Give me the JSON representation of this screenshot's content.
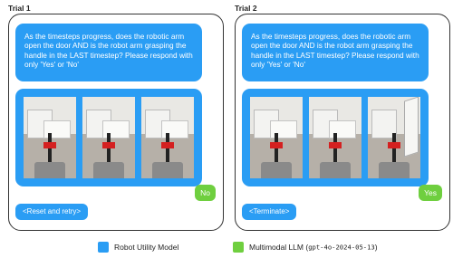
{
  "colors": {
    "robot_utility_blue": "#2a9df4",
    "llm_green": "#6fcf3f"
  },
  "trials": [
    {
      "label": "Trial 1",
      "question": "As the timesteps progress, does the robotic arm open the door AND is the robot arm grasping the handle in the LAST timestep? Please respond with only 'Yes' or 'No'",
      "answer": "No",
      "action": "<Reset and retry>"
    },
    {
      "label": "Trial 2",
      "question": "As the timesteps progress, does the robotic arm open the door AND is the robot arm grasping the handle in the LAST timestep? Please respond with only 'Yes' or 'No'",
      "answer": "Yes",
      "action": "<Terminate>"
    }
  ],
  "legend": {
    "robot_utility": "Robot Utility Model",
    "llm_prefix": "Multimodal LLM (",
    "llm_model": "gpt-4o-2024-05-13",
    "llm_suffix": ")"
  }
}
